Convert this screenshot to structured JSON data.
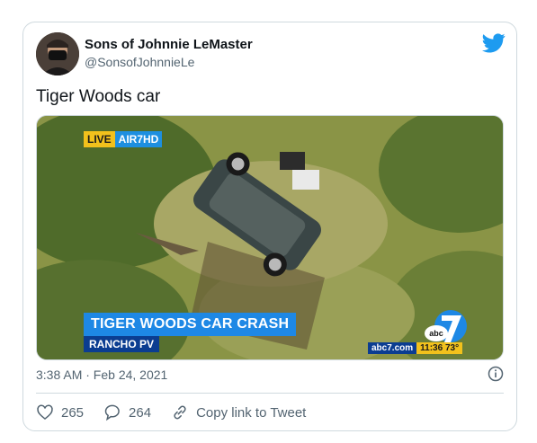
{
  "tweet": {
    "author_name": "Sons of Johnnie LeMaster",
    "author_handle": "@SonsofJohnnieLe",
    "text": "Tiger Woods car",
    "timestamp": "3:38 AM · Feb 24, 2021",
    "likes": "265",
    "replies": "264",
    "copy_link_label": "Copy link to Tweet"
  },
  "media": {
    "live_label": "LIVE",
    "channel_label": "AIR7HD",
    "headline": "TIGER WOODS CAR CRASH",
    "location": "RANCHO PV",
    "site": "abc7.com",
    "clock": "11:36 73°"
  },
  "icons": {
    "brand": "twitter-bird-icon",
    "info": "info-icon",
    "like": "heart-icon",
    "reply": "reply-icon",
    "link": "link-icon"
  },
  "colors": {
    "twitter_blue": "#1d9bf0",
    "text_secondary": "#536471",
    "border": "#cfd9de"
  }
}
